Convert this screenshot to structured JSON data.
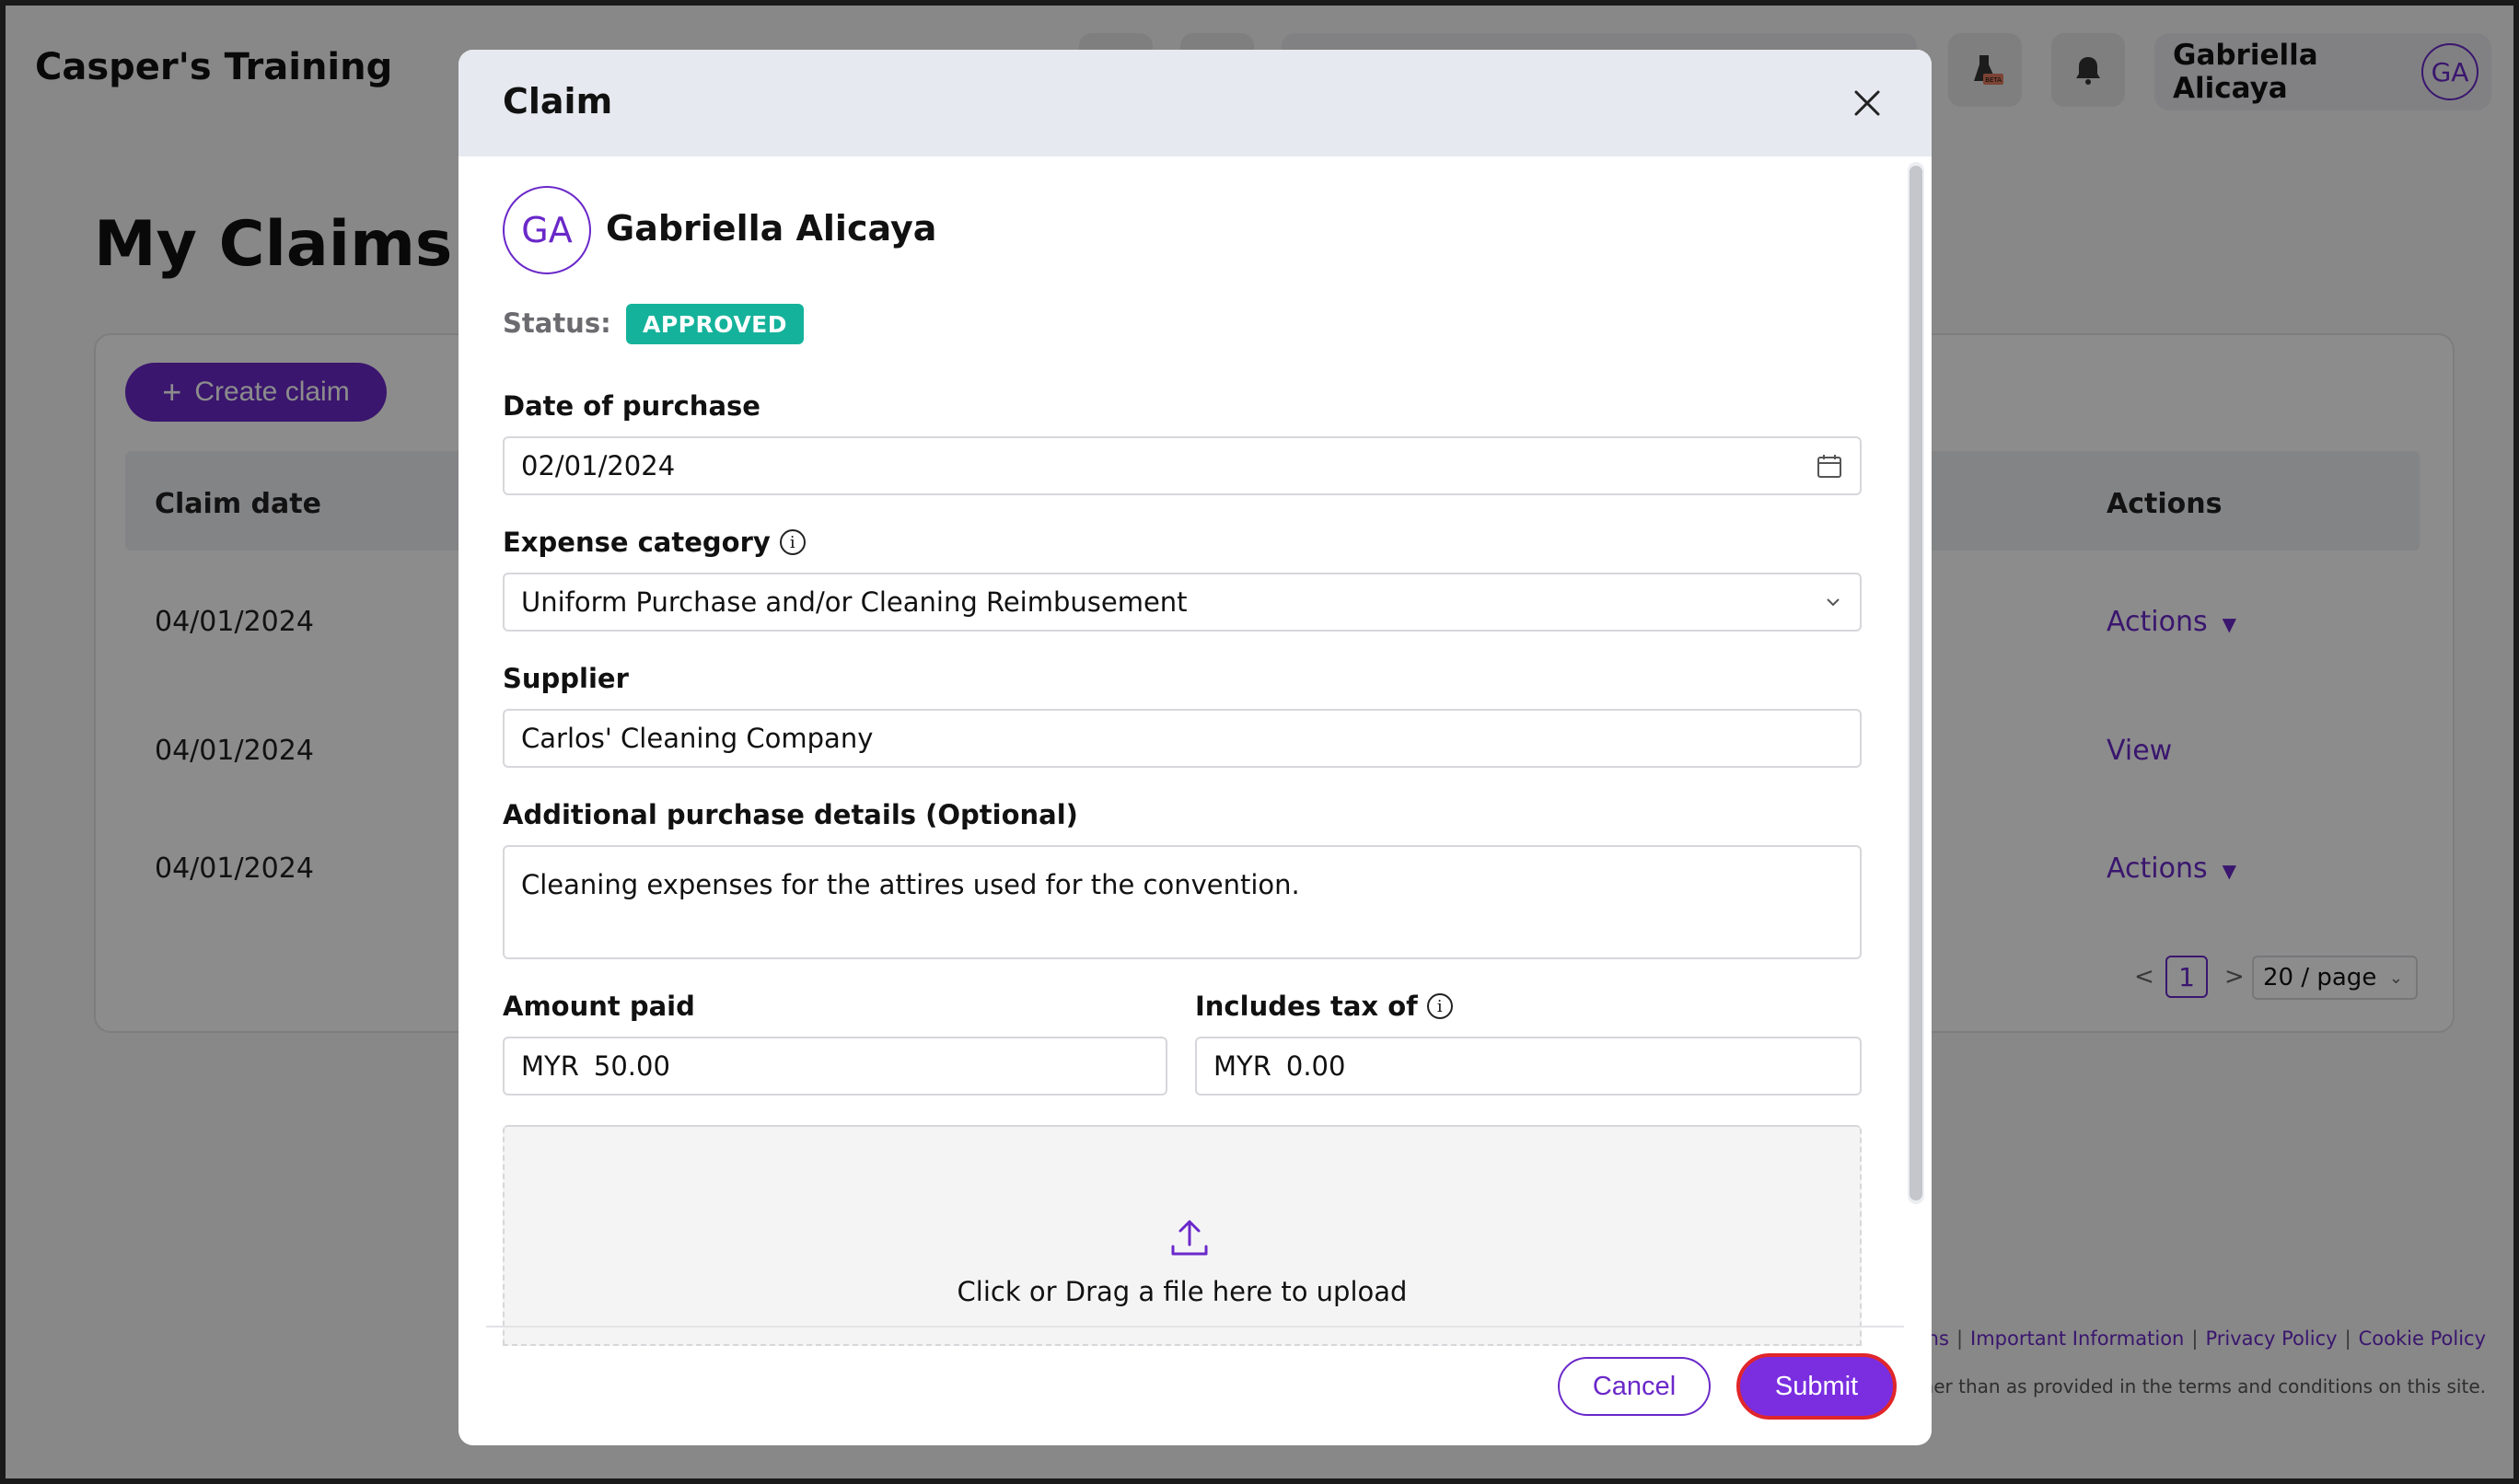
{
  "app": {
    "brand": "Casper's Training"
  },
  "header": {
    "user_name": "Gabriella Alicaya",
    "user_initials": "GA",
    "beta_badge": "BETA"
  },
  "page": {
    "title": "My Claims",
    "create_button": "Create claim"
  },
  "table": {
    "headers": {
      "claim_date": "Claim date",
      "actions": "Actions"
    },
    "rows": [
      {
        "date": "04/01/2024",
        "action": "Actions"
      },
      {
        "date": "04/01/2024",
        "action": "View"
      },
      {
        "date": "04/01/2024",
        "action": "Actions"
      }
    ]
  },
  "pagination": {
    "prev": "<",
    "current": "1",
    "next": ">",
    "page_size": "20 / page"
  },
  "footer": {
    "links": [
      "ditions",
      "Important Information",
      "Privacy Policy",
      "Cookie Policy"
    ],
    "note": "other than as provided in the terms and conditions on this site."
  },
  "modal": {
    "title": "Claim",
    "claimant_initials": "GA",
    "claimant_name": "Gabriella Alicaya",
    "status_label": "Status:",
    "status_value": "APPROVED",
    "date_label": "Date of purchase",
    "date_value": "02/01/2024",
    "category_label": "Expense category",
    "category_value": "Uniform Purchase and/or Cleaning Reimbusement",
    "supplier_label": "Supplier",
    "supplier_value": "Carlos' Cleaning Company",
    "details_label": "Additional purchase details (Optional)",
    "details_value": "Cleaning expenses for the attires used for the convention.",
    "amount_label": "Amount paid",
    "amount_currency": "MYR",
    "amount_value": "50.00",
    "tax_label": "Includes tax of",
    "tax_currency": "MYR",
    "tax_value": "0.00",
    "upload_text": "Click or Drag a file here to upload",
    "cancel_label": "Cancel",
    "submit_label": "Submit"
  },
  "colors": {
    "accent": "#6a28c9",
    "status_approved": "#15b29b",
    "submit_outline": "#e0262b"
  }
}
